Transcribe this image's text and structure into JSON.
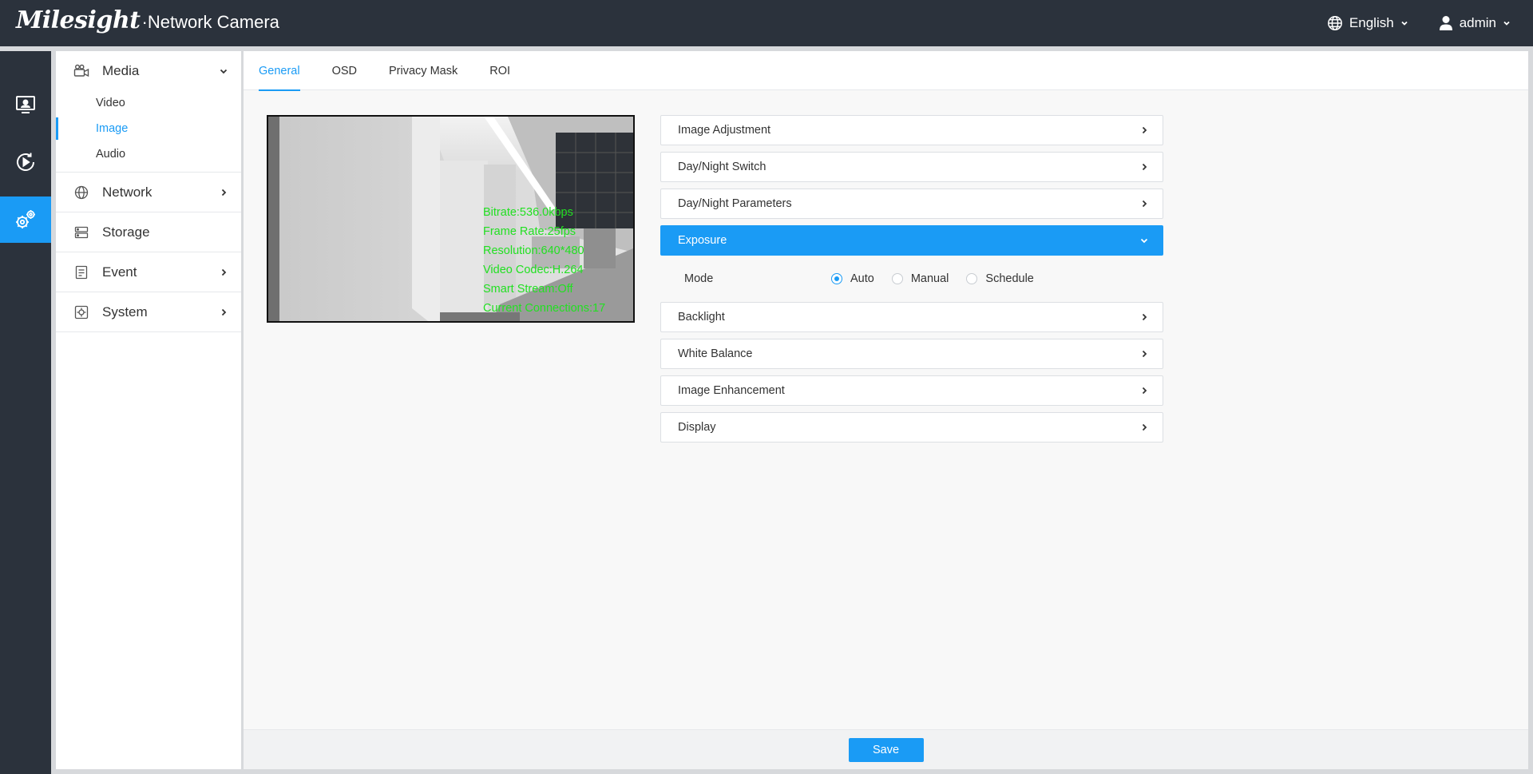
{
  "header": {
    "brand": "Milesight",
    "product": "·Network Camera",
    "language": "English",
    "user": "admin"
  },
  "rail": {
    "items": [
      {
        "icon": "live-view-icon",
        "active": false
      },
      {
        "icon": "playback-icon",
        "active": false
      },
      {
        "icon": "settings-icon",
        "active": true
      }
    ]
  },
  "sidebar": {
    "groups": [
      {
        "label": "Media",
        "icon": "camera-icon",
        "expanded": true,
        "children": [
          "Video",
          "Image",
          "Audio"
        ],
        "active_child": "Image"
      },
      {
        "label": "Network",
        "icon": "globe-icon",
        "expanded": false
      },
      {
        "label": "Storage",
        "icon": "storage-icon",
        "expanded": false
      },
      {
        "label": "Event",
        "icon": "event-icon",
        "expanded": false
      },
      {
        "label": "System",
        "icon": "system-icon",
        "expanded": false
      }
    ]
  },
  "tabs": [
    "General",
    "OSD",
    "Privacy Mask",
    "ROI"
  ],
  "active_tab": "General",
  "preview": {
    "osd_lines": [
      "Bitrate:536.0kbps",
      "Frame Rate:25fps",
      "Resolution:640*480",
      "Video Codec:H.264",
      "Smart Stream:Off",
      "Current Connections:17"
    ],
    "osd_color": "#22e022"
  },
  "panels": [
    {
      "label": "Image Adjustment",
      "open": false
    },
    {
      "label": "Day/Night Switch",
      "open": false
    },
    {
      "label": "Day/Night Parameters",
      "open": false
    },
    {
      "label": "Exposure",
      "open": true
    },
    {
      "label": "Backlight",
      "open": false
    },
    {
      "label": "White Balance",
      "open": false
    },
    {
      "label": "Image Enhancement",
      "open": false
    },
    {
      "label": "Display",
      "open": false
    }
  ],
  "exposure": {
    "mode_label": "Mode",
    "options": [
      "Auto",
      "Manual",
      "Schedule"
    ],
    "selected": "Auto"
  },
  "footer": {
    "save_label": "Save"
  },
  "colors": {
    "accent": "#1a9bf5",
    "header_bg": "#2b323c"
  }
}
